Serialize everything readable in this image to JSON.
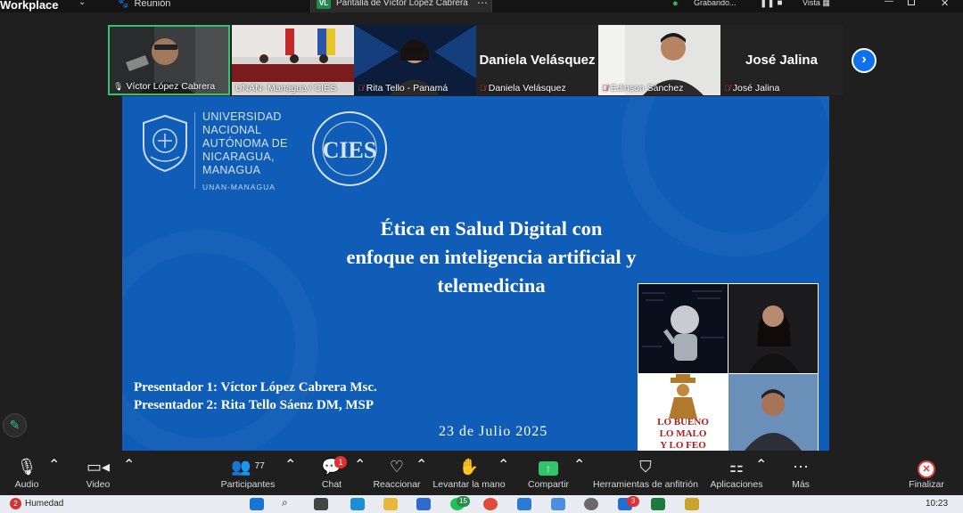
{
  "topbar": {
    "app_name": "Workplace",
    "meeting_name": "Reunión",
    "share_tab_initials": "VL",
    "share_tab_label": "Pantalla de Víctor López Cabrera",
    "recording_label": "Grabando...",
    "view_label": "Vista"
  },
  "participants": [
    {
      "name": "Víctor López Cabrera",
      "muted": false
    },
    {
      "name": "UNAN- Managua / CIES",
      "muted": false
    },
    {
      "name": "Rita Tello - Panamá",
      "muted": true
    },
    {
      "name": "Daniela Velásquez",
      "muted": true,
      "big_name": "Daniela Velásquez"
    },
    {
      "name": "Edinson Sánchez",
      "muted": true
    },
    {
      "name": "José Jalina",
      "muted": true,
      "big_name": "José Jalina"
    }
  ],
  "slide": {
    "university_lines": [
      "UNIVERSIDAD",
      "NACIONAL",
      "AUTÓNOMA DE",
      "NICARAGUA,",
      "MANAGUA"
    ],
    "university_short": "UNAN-MANAGUA",
    "cies_letters": "CIES",
    "title_lines": [
      "Ética en Salud Digital con",
      "enfoque en inteligencia artificial y",
      "telemedicina"
    ],
    "presenter_1": "Presentador 1: Víctor López Cabrera  Msc.",
    "presenter_2": "Presentador 2: Rita Tello Sáenz DM, MSP",
    "date": "23 de Julio 2025",
    "book_lines": [
      "LO BUENO",
      "LO MALO",
      "Y LO FEO"
    ]
  },
  "toolbar": {
    "audio": "Audio",
    "video": "Video",
    "participants": "Participantes",
    "participants_count": "77",
    "chat": "Chat",
    "chat_badge": "1",
    "reactions": "Reaccionar",
    "raise_hand": "Levantar la mano",
    "share": "Compartir",
    "host_tools": "Herramientas de anfitrión",
    "apps": "Aplicaciones",
    "more": "Más",
    "end": "Finalizar"
  },
  "taskbar": {
    "weather_badge": "2",
    "weather": "Humedad",
    "whatsapp_badge": "15",
    "mail_badge": "3",
    "clock": "10:23"
  },
  "colors": {
    "slide_blue": "#0f5db7",
    "active_speaker": "#31c46b",
    "share_green": "#31c46b",
    "end_red": "#e03b3b",
    "next_blue": "#0e72ed"
  }
}
